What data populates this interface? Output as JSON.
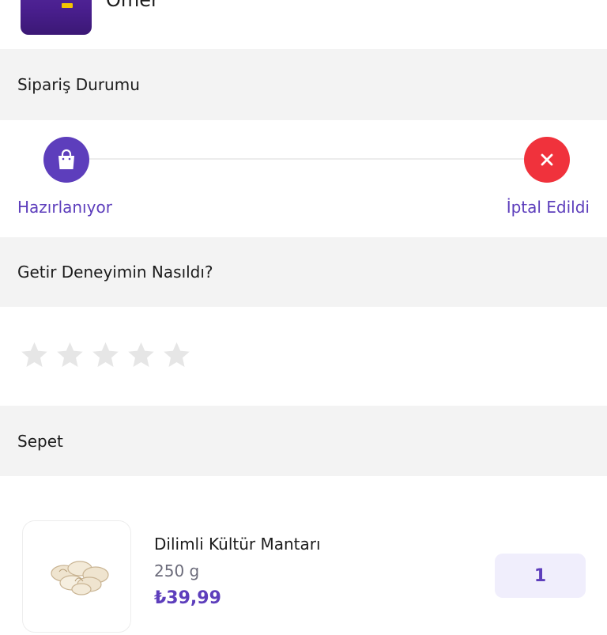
{
  "courier": {
    "name": "Ömer"
  },
  "order_status": {
    "title": "Sipariş Durumu",
    "steps": [
      {
        "label": "Hazırlanıyor",
        "icon": "shopping-bag-icon"
      },
      {
        "label": "İptal Edildi",
        "icon": "close-icon"
      }
    ]
  },
  "rating": {
    "title": "Getir Deneyimin Nasıldı?",
    "stars_total": 5,
    "stars_selected": 0
  },
  "basket": {
    "title": "Sepet",
    "items": [
      {
        "name": "Dilimli Kültür Mantarı",
        "weight": "250 g",
        "price": "₺39,99",
        "quantity": "1"
      }
    ]
  },
  "colors": {
    "brand_purple": "#5d3ebc",
    "cancel_red": "#f0323c",
    "section_bg": "#f3f3f3",
    "star_gray": "#e6e6e6"
  }
}
